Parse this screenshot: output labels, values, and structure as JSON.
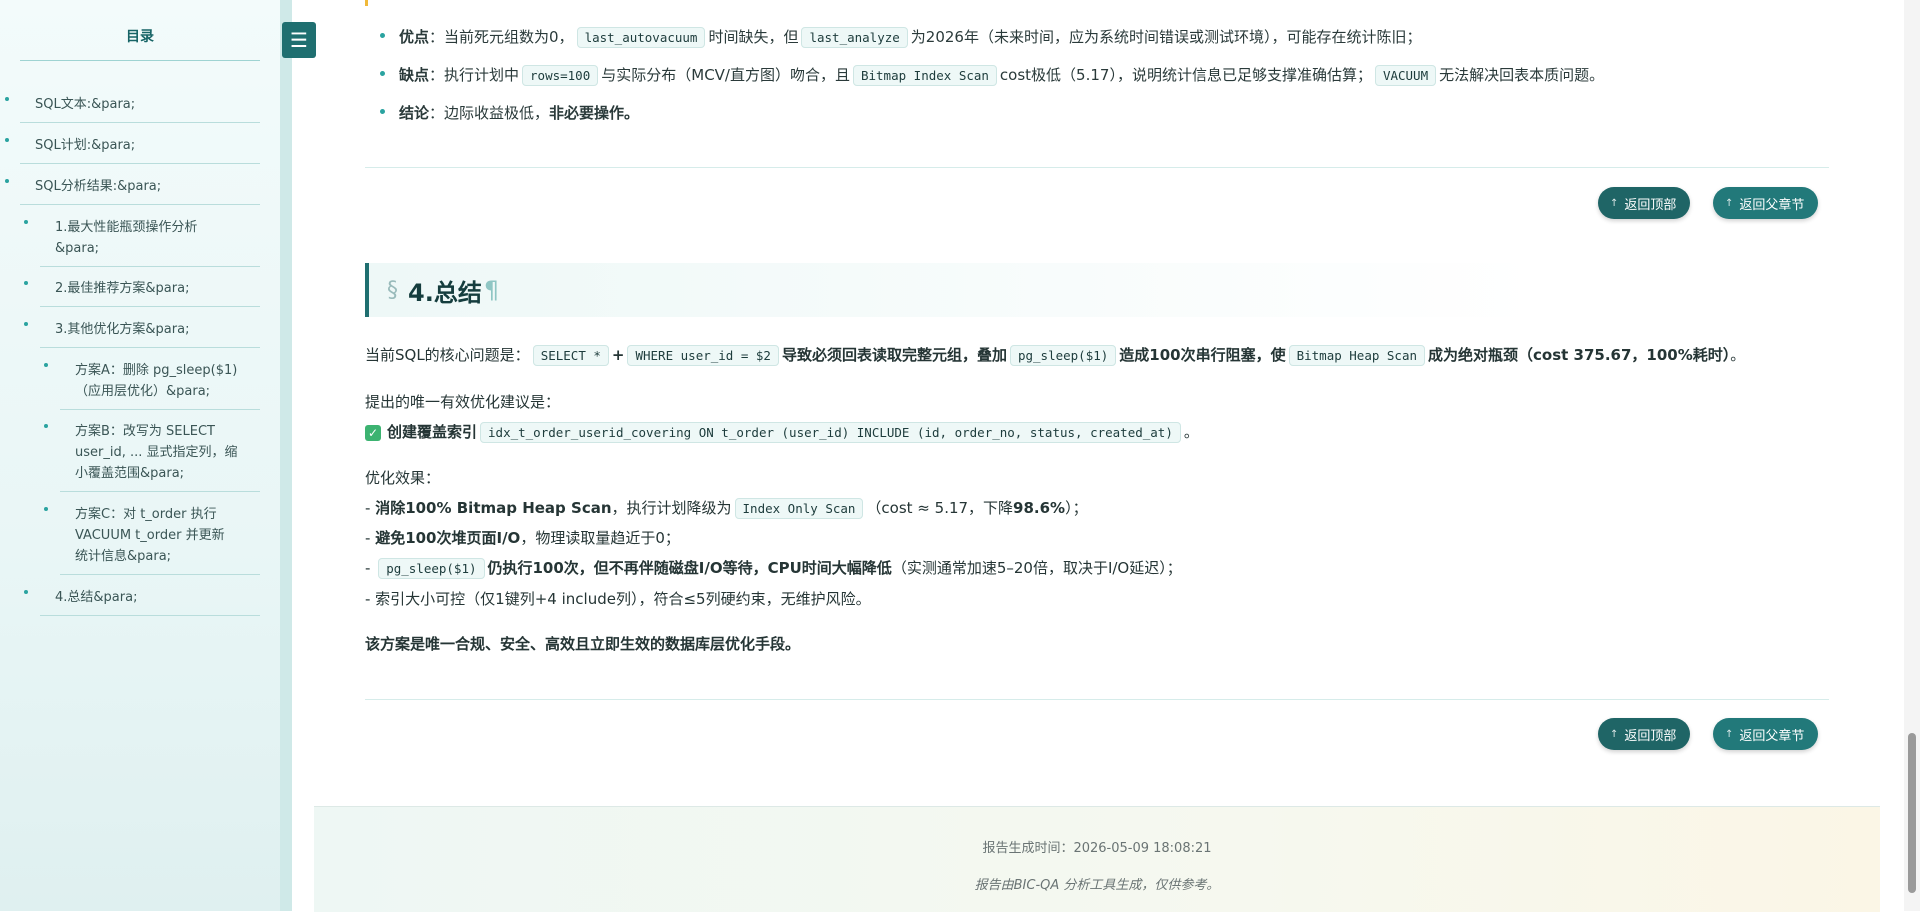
{
  "toc": {
    "title": "目录",
    "items": [
      {
        "label": "SQL文本:&para;"
      },
      {
        "label": "SQL计划:&para;"
      },
      {
        "label": "SQL分析结果:&para;"
      },
      {
        "label_l1": "1.最大性能瓶颈操作分析",
        "label_l2": "&para;"
      },
      {
        "label": "2.最佳推荐方案&para;"
      },
      {
        "label": "3.其他优化方案&para;"
      },
      {
        "label_l1": "方案A：删除 pg_sleep($1)",
        "label_l2": "（应用层优化）&para;"
      },
      {
        "label_l1": "方案B：改写为 SELECT",
        "label_l2": "user_id, ... 显式指定列，缩",
        "label_l3": "小覆盖范围&para;"
      },
      {
        "label_l1": "方案C：对 t_order 执行",
        "label_l2": "VACUUM t_order 并更新",
        "label_l3": "统计信息&para;"
      },
      {
        "label": "4.总结&para;"
      }
    ],
    "toggle_icon": "menu-icon"
  },
  "pros_cons": {
    "pros_label": "优点",
    "pros_text1": "：当前死元组数为0，",
    "pros_code1": "last_autovacuum",
    "pros_text2": "时间缺失，但",
    "pros_code2": "last_analyze",
    "pros_text3": "为2026年（未来时间，应为系统时间错误或测试环境），可能存在统计陈旧；",
    "cons_label": "缺点",
    "cons_text1": "：执行计划中",
    "cons_code1": "rows=100",
    "cons_text2": "与实际分布（MCV/直方图）吻合，且",
    "cons_code2": "Bitmap Index Scan",
    "cons_text3": "cost极低（5.17），说明统计信息已足够支撑准确估算；",
    "cons_code3": "VACUUM",
    "cons_text4": "无法解决回表本质问题。",
    "concl_label": "结论",
    "concl_text": "：边际收益极低，",
    "concl_bold": "非必要操作。"
  },
  "buttons": {
    "back_top": "返回顶部",
    "back_parent": "返回父章节"
  },
  "summary": {
    "heading_sect": "§",
    "heading": "4.总结",
    "heading_pil": "¶",
    "core_prefix": "当前SQL的核心问题是：",
    "core_code1": "SELECT *",
    "core_plus": "+",
    "core_code2": "WHERE user_id = $2",
    "core_bold1": "导致必须回表读取完整元组，叠加",
    "core_code3": "pg_sleep($1)",
    "core_bold2": "造成100次串行阻塞，使",
    "core_code4": "Bitmap Heap Scan",
    "core_bold3": "成为绝对瓶颈（cost 375.67，100%耗时）",
    "core_end": "。",
    "suggest_label": "提出的唯一有效优化建议是：",
    "suggest_check": "✓",
    "suggest_bold": "创建覆盖索引",
    "suggest_code": "idx_t_order_userid_covering ON t_order (user_id) INCLUDE (id, order_no, status, created_at)",
    "suggest_end": "。",
    "effect_label": "优化效果：",
    "e1_dash": "- ",
    "e1_bold": "消除100% Bitmap Heap Scan",
    "e1_text1": "，执行计划降级为",
    "e1_code": "Index Only Scan",
    "e1_text2": "（cost ≈ 5.17，下降",
    "e1_bold2": "98.6%",
    "e1_text3": "）；",
    "e2_dash": "- ",
    "e2_bold": "避免100次堆页面I/O",
    "e2_text": "，物理读取量趋近于0；",
    "e3_dash": "- ",
    "e3_code": "pg_sleep($1)",
    "e3_bold": "仍执行100次，但不再伴随磁盘I/O等待，CPU时间大幅降低",
    "e3_text": "（实测通常加速5–20倍，取决于I/O延迟）；",
    "e4_text": "- 索引大小可控（仅1键列+4 include列），符合≤5列硬约束，无维护风险。",
    "final_bold": "该方案是唯一合规、安全、高效且立即生效的数据库层优化手段。"
  },
  "footer": {
    "generated": "报告生成时间：2026-05-09 18:08:21",
    "note": "报告由BIC-QA 分析工具生成，仅供参考。"
  }
}
